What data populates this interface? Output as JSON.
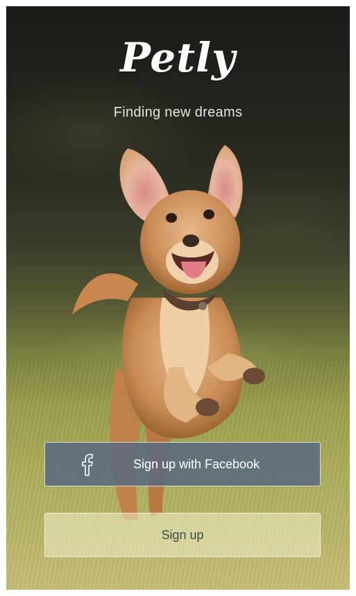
{
  "app": {
    "logo": "Petly",
    "tagline": "Finding new dreams"
  },
  "buttons": {
    "facebook_label": "Sign up with Facebook",
    "facebook_icon": "facebook-f-icon",
    "signup_label": "Sign up"
  },
  "colors": {
    "facebook_button": "#586980",
    "signup_button": "#f1f1c8",
    "signup_text": "#3c4f47",
    "text": "#ffffff"
  }
}
